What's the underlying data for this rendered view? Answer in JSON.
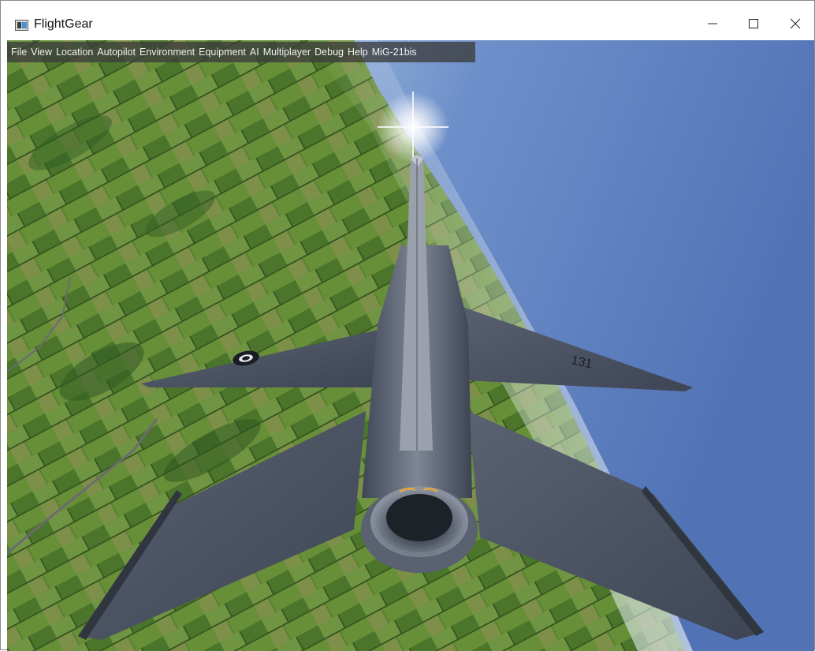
{
  "window": {
    "title": "FlightGear",
    "icon": "flightgear-app-icon"
  },
  "controls": {
    "minimize": "minimize-icon",
    "maximize": "maximize-icon",
    "close": "close-icon"
  },
  "menu": {
    "items": [
      "File",
      "View",
      "Location",
      "Autopilot",
      "Environment",
      "Equipment",
      "AI",
      "Multiplayer",
      "Debug",
      "Help",
      "MiG-21bis"
    ]
  },
  "scene": {
    "aircraft_marking": "131",
    "colors": {
      "sky": "#5b7fc0",
      "terrain": "#5b7a35",
      "aircraft": "#4d5566"
    }
  }
}
